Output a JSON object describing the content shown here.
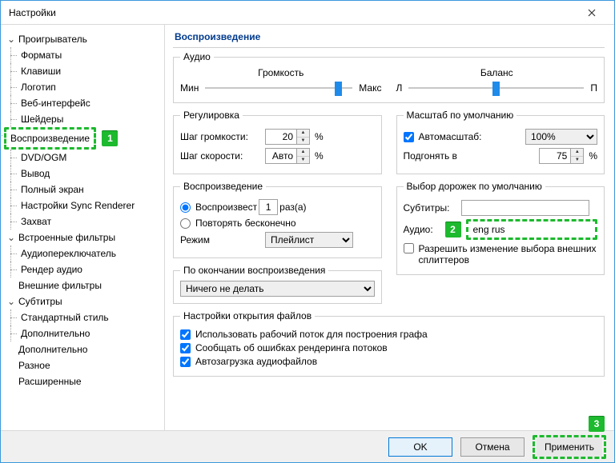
{
  "window": {
    "title": "Настройки"
  },
  "tree": {
    "player": {
      "label": "Проигрыватель",
      "children": [
        "Форматы",
        "Клавиши",
        "Логотип",
        "Веб-интерфейс",
        "Шейдеры",
        "Воспроизведение",
        "DVD/OGM",
        "Вывод",
        "Полный экран",
        "Настройки Sync Renderer",
        "Захват"
      ],
      "selected_index": 5
    },
    "filters_builtin": {
      "label": "Встроенные фильтры",
      "children": [
        "Аудиопереключатель",
        "Рендер аудио"
      ]
    },
    "filters_external": {
      "label": "Внешние фильтры"
    },
    "subtitles": {
      "label": "Субтитры",
      "children": [
        "Стандартный стиль",
        "Дополнительно"
      ]
    },
    "other": [
      "Дополнительно",
      "Разное",
      "Расширенные"
    ]
  },
  "panel": {
    "header": "Воспроизведение",
    "audio": {
      "legend": "Аудио",
      "volume_label": "Громкость",
      "balance_label": "Баланс",
      "min": "Мин",
      "max": "Макс",
      "left": "Л",
      "right": "П",
      "volume_pos_pct": 90,
      "balance_pos_pct": 50
    },
    "regulate": {
      "legend": "Регулировка",
      "vol_step_label": "Шаг громкости:",
      "vol_step_value": "20",
      "speed_step_label": "Шаг скорости:",
      "speed_step_value": "Авто",
      "percent": "%"
    },
    "scale": {
      "legend": "Масштаб по умолчанию",
      "auto_label": "Автомасштаб:",
      "auto_checked": true,
      "auto_value": "100%",
      "fit_label": "Подгонять в",
      "fit_value": "75",
      "percent": "%"
    },
    "playback": {
      "legend": "Воспроизведение",
      "play_label": "Воспроизвест",
      "play_count": "1",
      "times": "раз(а)",
      "repeat_label": "Повторять бесконечно",
      "mode_label": "Режим",
      "mode_value": "Плейлист"
    },
    "tracks": {
      "legend": "Выбор дорожек по умолчанию",
      "subs_label": "Субтитры:",
      "subs_value": "",
      "audio_label": "Аудио:",
      "audio_value": "eng rus",
      "allow_label": "Разрешить изменение выбора внешних сплиттеров",
      "allow_checked": false
    },
    "on_end": {
      "legend": "По окончании воспроизведения",
      "value": "Ничего не делать"
    },
    "open_files": {
      "legend": "Настройки открытия файлов",
      "opt1": "Использовать рабочий поток для построения графа",
      "opt2": "Сообщать об ошибках рендеринга потоков",
      "opt3": "Автозагрузка аудиофайлов",
      "c1": true,
      "c2": true,
      "c3": true
    }
  },
  "buttons": {
    "ok": "OK",
    "cancel": "Отмена",
    "apply": "Применить"
  },
  "annotations": {
    "n1": "1",
    "n2": "2",
    "n3": "3"
  }
}
